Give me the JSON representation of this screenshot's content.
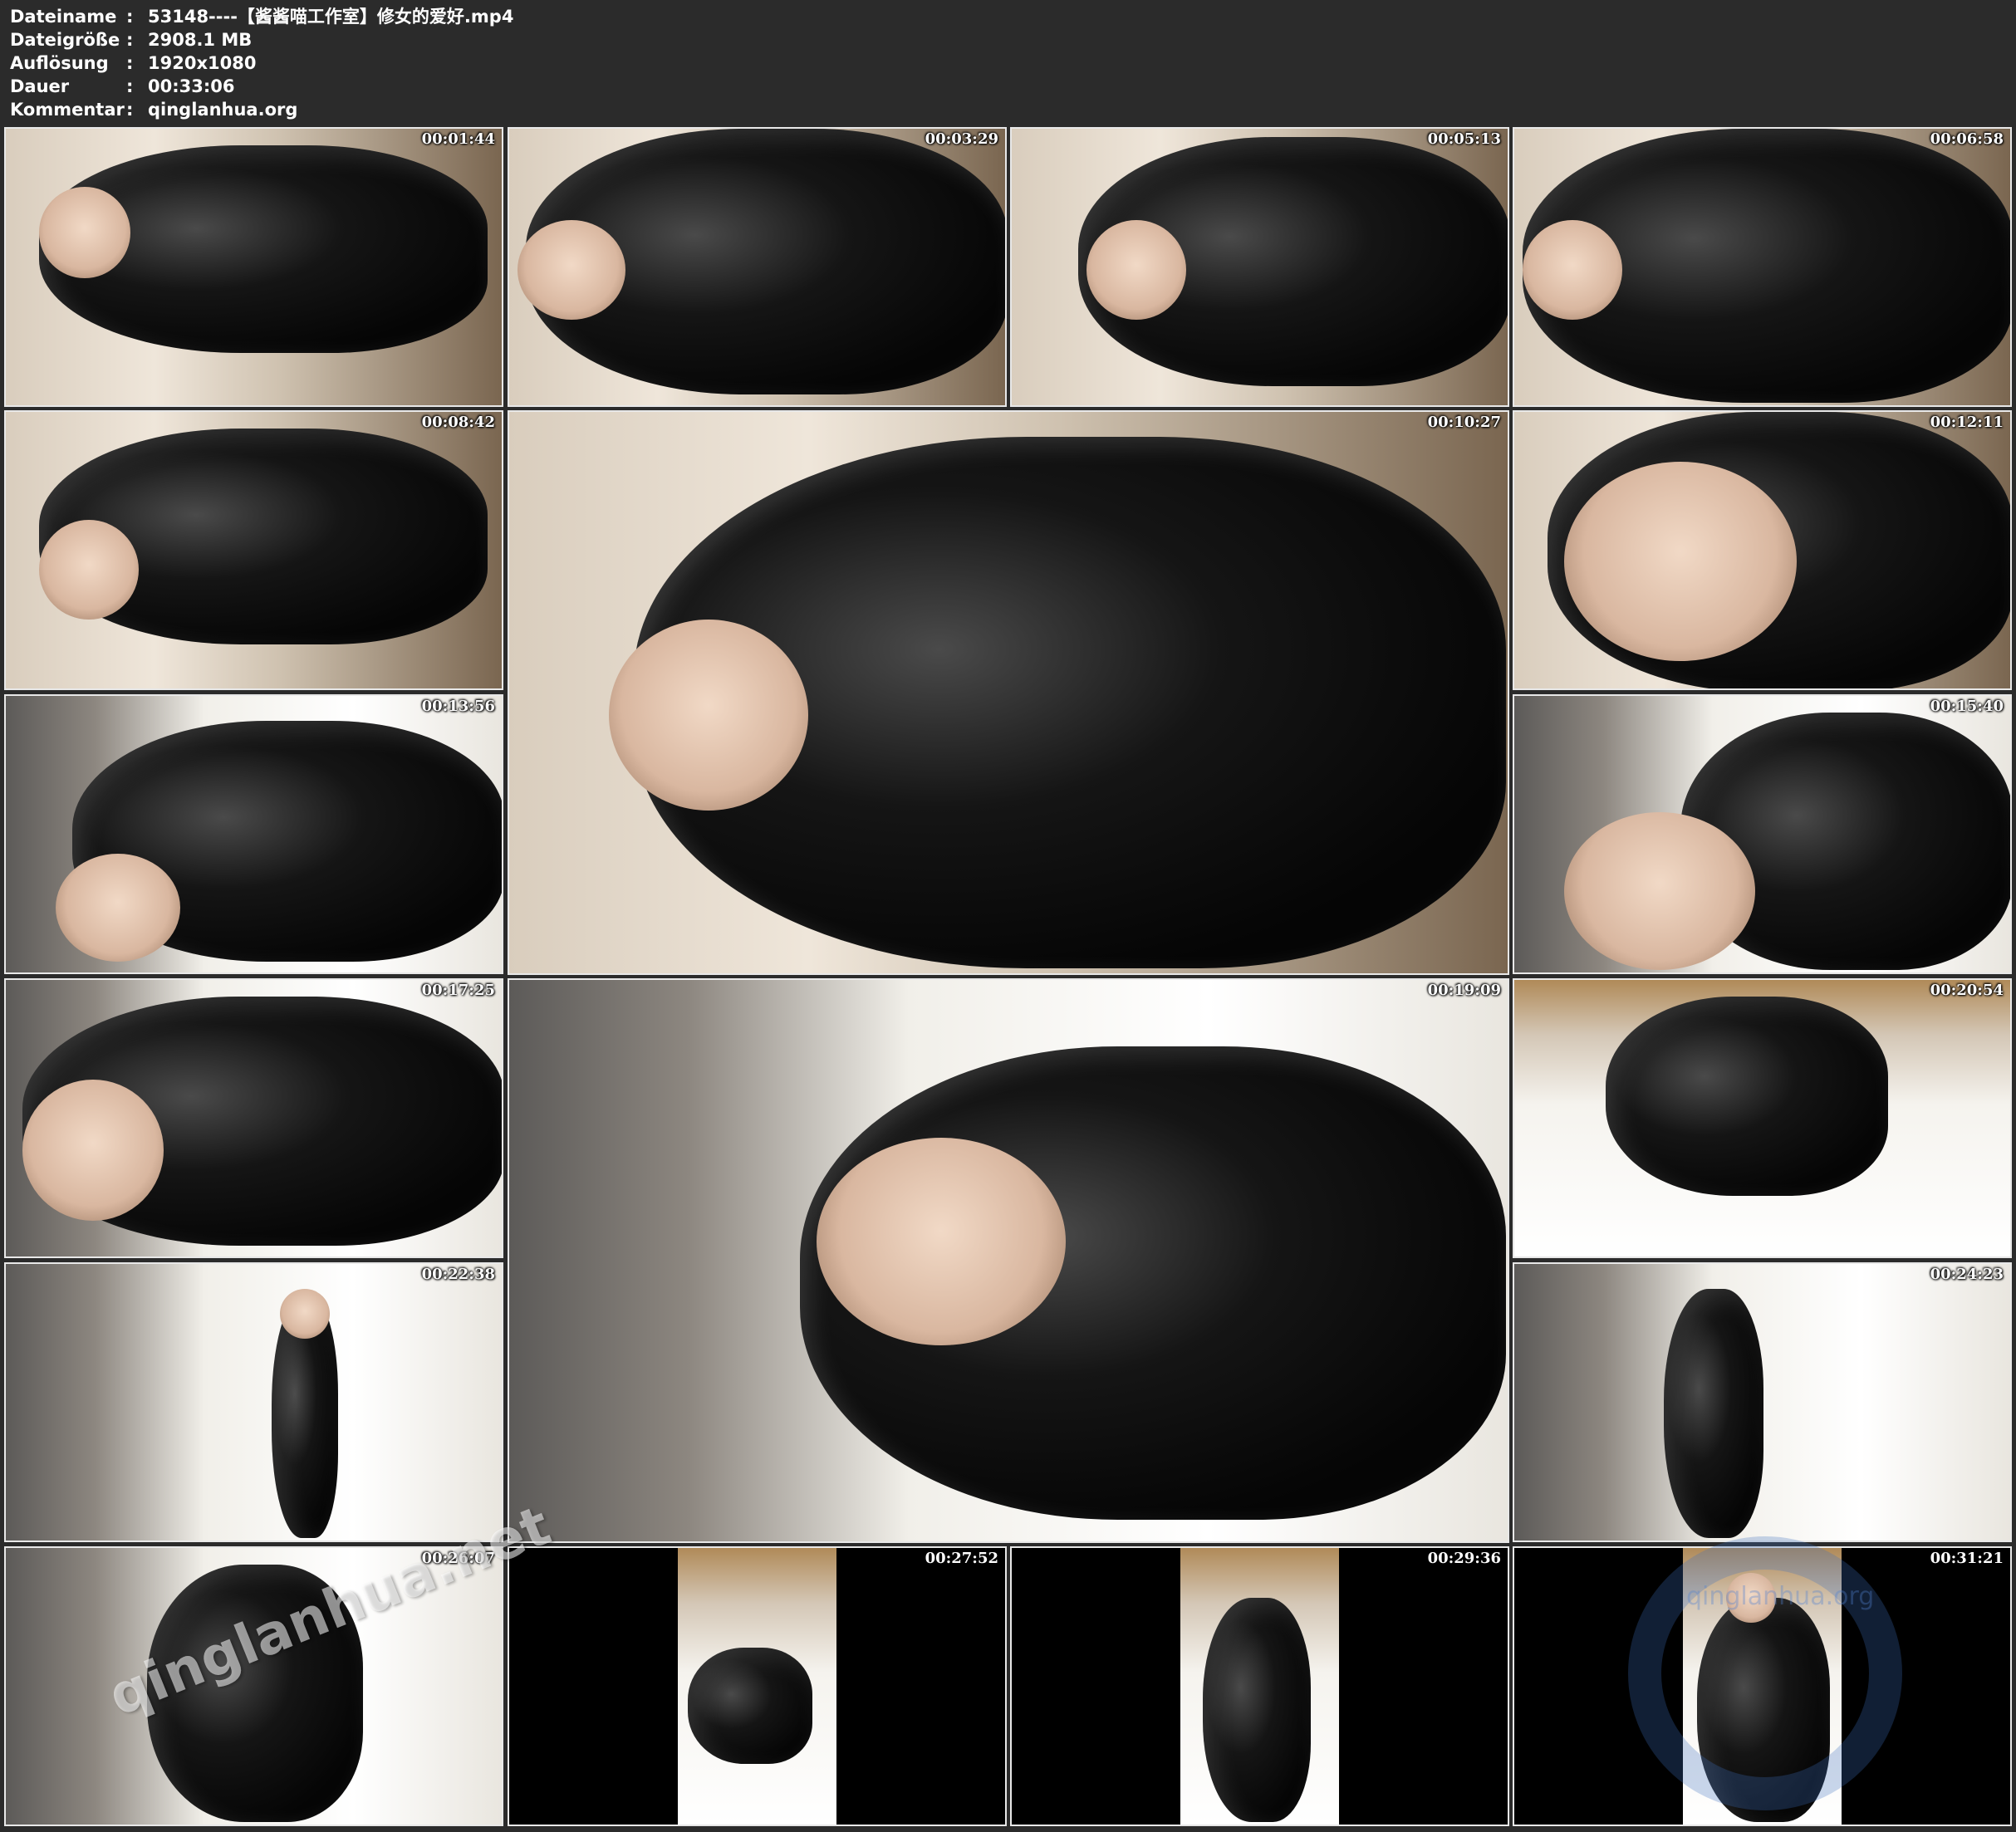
{
  "header": {
    "rows": [
      {
        "label": "Dateiname",
        "sep": ":",
        "value": "53148----【酱酱喵工作室】修女的爱好.mp4"
      },
      {
        "label": "Dateigröße",
        "sep": ":",
        "value": "2908.1 MB"
      },
      {
        "label": "Auflösung",
        "sep": ":",
        "value": "1920x1080"
      },
      {
        "label": "Dauer",
        "sep": ":",
        "value": "00:33:06"
      },
      {
        "label": "Kommentar",
        "sep": ":",
        "value": "qinglanhua.org"
      }
    ]
  },
  "thumbnails": [
    {
      "timestamp": "00:01:44"
    },
    {
      "timestamp": "00:03:29"
    },
    {
      "timestamp": "00:05:13"
    },
    {
      "timestamp": "00:06:58"
    },
    {
      "timestamp": "00:08:42"
    },
    {
      "timestamp": "00:10:27"
    },
    {
      "timestamp": "00:12:11"
    },
    {
      "timestamp": "00:13:56"
    },
    {
      "timestamp": "00:15:40"
    },
    {
      "timestamp": "00:17:25"
    },
    {
      "timestamp": "00:19:09"
    },
    {
      "timestamp": "00:20:54"
    },
    {
      "timestamp": "00:22:38"
    },
    {
      "timestamp": "00:24:23"
    },
    {
      "timestamp": "00:26:07"
    },
    {
      "timestamp": "00:27:52"
    },
    {
      "timestamp": "00:29:36"
    },
    {
      "timestamp": "00:31:21"
    }
  ],
  "watermarks": {
    "overlay_text": "qinglanhua.net",
    "logo_text": "qinglanhua.org"
  },
  "colors": {
    "background": "#2b2b2b",
    "text": "#ffffff",
    "frame_border": "#e8e8e8"
  }
}
